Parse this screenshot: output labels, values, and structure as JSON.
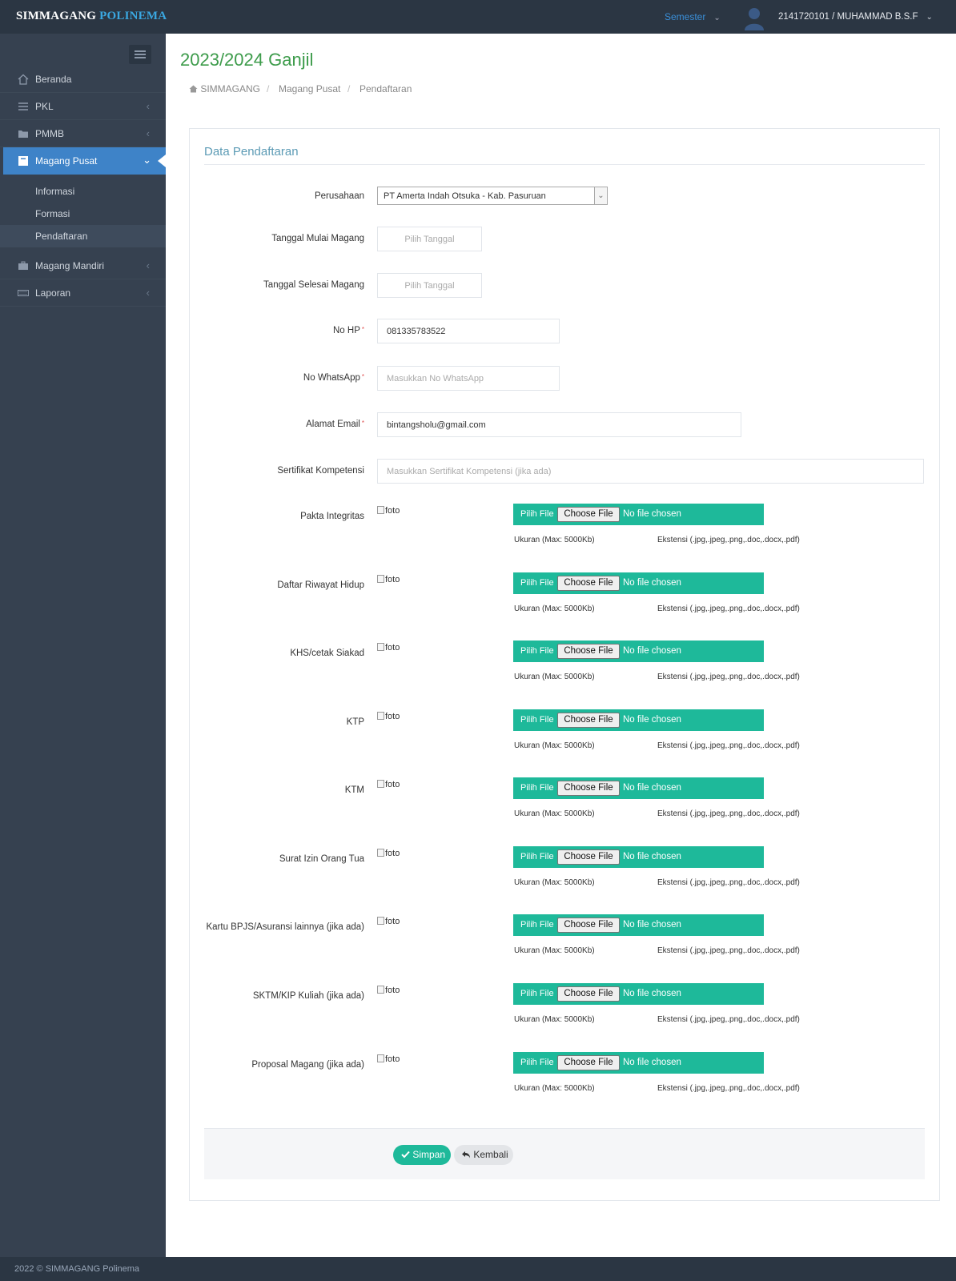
{
  "header": {
    "brand_main": "SIMMAGANG",
    "brand_accent": "POLINEMA",
    "semester_label": "Semester",
    "user_label": "2141720101 / MUHAMMAD B.S.F"
  },
  "sidebar": {
    "items": [
      {
        "label": "Beranda",
        "icon": "home-icon"
      },
      {
        "label": "PKL",
        "icon": "list-icon"
      },
      {
        "label": "PMMB",
        "icon": "folder-icon"
      },
      {
        "label": "Magang Pusat",
        "icon": "archive-icon"
      },
      {
        "label": "Magang Mandiri",
        "icon": "briefcase-icon"
      },
      {
        "label": "Laporan",
        "icon": "keyboard-icon"
      }
    ],
    "subitems": [
      {
        "label": "Informasi"
      },
      {
        "label": "Formasi"
      },
      {
        "label": "Pendaftaran"
      }
    ]
  },
  "page": {
    "title": "2023/2024 Ganjil",
    "breadcrumb": [
      "SIMMAGANG",
      "Magang Pusat",
      "Pendaftaran"
    ]
  },
  "form": {
    "title": "Data Pendaftaran",
    "perusahaan": {
      "label": "Perusahaan",
      "value": "PT Amerta Indah Otsuka - Kab. Pasuruan"
    },
    "tanggal_mulai": {
      "label": "Tanggal Mulai Magang",
      "placeholder": "Pilih Tanggal"
    },
    "tanggal_selesai": {
      "label": "Tanggal Selesai Magang",
      "placeholder": "Pilih Tanggal"
    },
    "no_hp": {
      "label": "No HP",
      "required_mark": "*",
      "value": "081335783522"
    },
    "no_whatsapp": {
      "label": "No WhatsApp",
      "required_mark": "*",
      "placeholder": "Masukkan No WhatsApp"
    },
    "email": {
      "label": "Alamat Email",
      "required_mark": "*",
      "value": "bintangsholu@gmail.com"
    },
    "sertifikat": {
      "label": "Sertifikat Kompetensi",
      "placeholder": "Masukkan Sertifikat Kompetensi (jika ada)"
    },
    "uploads": [
      {
        "label": "Pakta Integritas"
      },
      {
        "label": "Daftar Riwayat Hidup"
      },
      {
        "label": "KHS/cetak Siakad"
      },
      {
        "label": "KTP"
      },
      {
        "label": "KTM"
      },
      {
        "label": "Surat Izin Orang Tua"
      },
      {
        "label": "Kartu BPJS/Asuransi lainnya (jika ada)"
      },
      {
        "label": "SKTM/KIP Kuliah (jika ada)"
      },
      {
        "label": "Proposal Magang (jika ada)"
      }
    ],
    "upload_common": {
      "foto_alt": "foto",
      "pick_label": "Pilih File",
      "choose_label": "Choose File",
      "no_file": "No file chosen",
      "size_hint": "Ukuran (Max: 5000Kb)",
      "ext_hint": "Ekstensi (.jpg,.jpeg,.png,.doc,.docx,.pdf)"
    },
    "save_label": "Simpan",
    "back_label": "Kembali"
  },
  "footer": {
    "text": "2022 © SIMMAGANG Polinema"
  },
  "colors": {
    "accent": "#1eb99a",
    "sidebar": "#364150",
    "active": "#3e83c8",
    "title": "#3c9b4a"
  }
}
